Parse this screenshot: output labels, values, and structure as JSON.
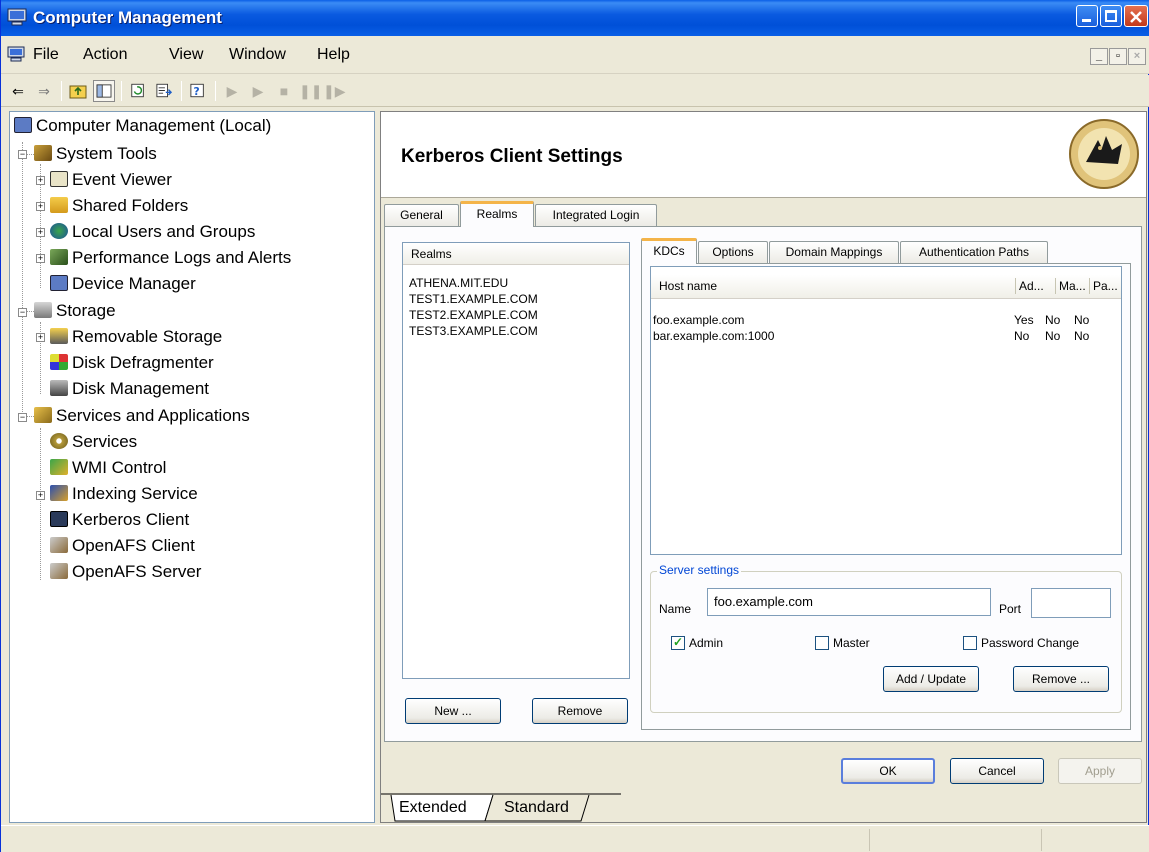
{
  "window": {
    "title": "Computer Management"
  },
  "menu": {
    "items": [
      "File",
      "Action",
      "View",
      "Window",
      "Help"
    ]
  },
  "tree": {
    "root": "Computer Management (Local)",
    "system_tools": "System Tools",
    "event_viewer": "Event Viewer",
    "shared_folders": "Shared Folders",
    "local_users": "Local Users and Groups",
    "perf_logs": "Performance Logs and Alerts",
    "device_manager": "Device Manager",
    "storage": "Storage",
    "removable_storage": "Removable Storage",
    "disk_defrag": "Disk Defragmenter",
    "disk_mgmt": "Disk Management",
    "services_apps": "Services and Applications",
    "services": "Services",
    "wmi": "WMI Control",
    "indexing": "Indexing Service",
    "kerberos": "Kerberos Client",
    "openafs_client": "OpenAFS Client",
    "openafs_server": "OpenAFS Server"
  },
  "header": {
    "title": "Kerberos Client Settings"
  },
  "main_tabs": [
    "General",
    "Realms",
    "Integrated Login"
  ],
  "realms": {
    "column": "Realms",
    "items": [
      "ATHENA.MIT.EDU",
      "TEST1.EXAMPLE.COM",
      "TEST2.EXAMPLE.COM",
      "TEST3.EXAMPLE.COM"
    ],
    "new_label": "New ...",
    "remove_label": "Remove"
  },
  "sub_tabs": [
    "KDCs",
    "Options",
    "Domain Mappings",
    "Authentication Paths"
  ],
  "kdcs": {
    "columns": [
      "Host name",
      "Ad...",
      "Ma...",
      "Pa..."
    ],
    "rows": [
      {
        "host": "foo.example.com",
        "admin": "Yes",
        "master": "No",
        "pw": "No"
      },
      {
        "host": "bar.example.com:1000",
        "admin": "No",
        "master": "No",
        "pw": "No"
      }
    ]
  },
  "server": {
    "group_label": "Server settings",
    "name_label": "Name",
    "name_value": "foo.example.com",
    "port_label": "Port",
    "port_value": "",
    "admin_label": "Admin",
    "master_label": "Master",
    "pwchange_label": "Password Change",
    "add_label": "Add / Update",
    "remove_label": "Remove ..."
  },
  "dialog": {
    "ok": "OK",
    "cancel": "Cancel",
    "apply": "Apply"
  },
  "view_tabs": [
    "Extended",
    "Standard"
  ]
}
